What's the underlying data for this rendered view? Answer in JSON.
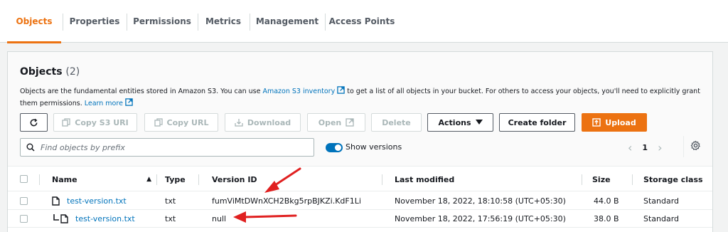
{
  "tabs": [
    {
      "label": "Objects",
      "active": true
    },
    {
      "label": "Properties"
    },
    {
      "label": "Permissions"
    },
    {
      "label": "Metrics"
    },
    {
      "label": "Management"
    },
    {
      "label": "Access Points"
    }
  ],
  "objects": {
    "title": "Objects",
    "count": "(2)",
    "desc_part1": "Objects are the fundamental entities stored in Amazon S3. You can use ",
    "desc_link": "Amazon S3 inventory",
    "desc_part2": " to get a list of all objects in your bucket. For others to access your objects, you'll need to explicitly grant them permissions. ",
    "learn_more": "Learn more"
  },
  "toolbar": {
    "copy_s3_uri": "Copy S3 URI",
    "copy_url": "Copy URL",
    "download": "Download",
    "open": "Open",
    "delete": "Delete",
    "actions": "Actions",
    "create_folder": "Create folder",
    "upload": "Upload"
  },
  "search": {
    "placeholder": "Find objects by prefix"
  },
  "show_versions": {
    "label": "Show versions",
    "on": true
  },
  "pagination": {
    "page": "1"
  },
  "table": {
    "headers": {
      "name": "Name",
      "type": "Type",
      "version_id": "Version ID",
      "last_modified": "Last modified",
      "size": "Size",
      "storage_class": "Storage class"
    },
    "rows": [
      {
        "name": "test-version.txt",
        "type": "txt",
        "version_id": "fumViMtDWnXCH2Bkg5rpBJKZi.KdF1Li",
        "last_modified": "November 18, 2022, 18:10:58 (UTC+05:30)",
        "size": "44.0 B",
        "storage_class": "Standard"
      },
      {
        "name": "test-version.txt",
        "type": "txt",
        "version_id": "null",
        "last_modified": "November 18, 2022, 17:56:19 (UTC+05:30)",
        "size": "38.0 B",
        "storage_class": "Standard"
      }
    ]
  },
  "colors": {
    "accent": "#ec7211",
    "link": "#0073bb",
    "annotation": "#e02020"
  }
}
